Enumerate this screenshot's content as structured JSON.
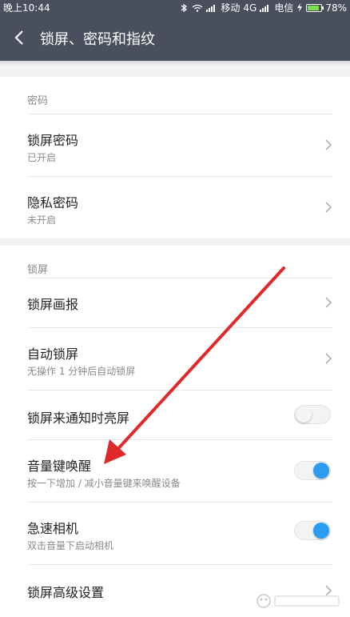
{
  "status_bar": {
    "time": "晚上10:44",
    "carrier1": "移动",
    "network": "4G",
    "carrier2": "电信",
    "battery": "78%",
    "battery_level": 0.78
  },
  "header": {
    "title": "锁屏、密码和指纹"
  },
  "sections": {
    "password": {
      "header": "密码",
      "items": [
        {
          "title": "锁屏密码",
          "subtitle": "已开启"
        },
        {
          "title": "隐私密码",
          "subtitle": "未开启"
        }
      ]
    },
    "lockscreen": {
      "header": "锁屏",
      "items": [
        {
          "title": "锁屏画报"
        },
        {
          "title": "自动锁屏",
          "subtitle": "无操作 1 分钟后自动锁屏"
        },
        {
          "title": "锁屏来通知时亮屏",
          "toggle": "off"
        },
        {
          "title": "音量键唤醒",
          "subtitle": "按一下增加 / 减小音量键来唤醒设备",
          "toggle": "on"
        },
        {
          "title": "急速相机",
          "subtitle": "双击音量下启动相机",
          "toggle": "on"
        },
        {
          "title": "锁屏高级设置"
        }
      ]
    }
  },
  "colors": {
    "header_bg": "#4a4f5e",
    "toggle_on": "#2b9df0",
    "annotation_arrow": "#e0292b"
  }
}
